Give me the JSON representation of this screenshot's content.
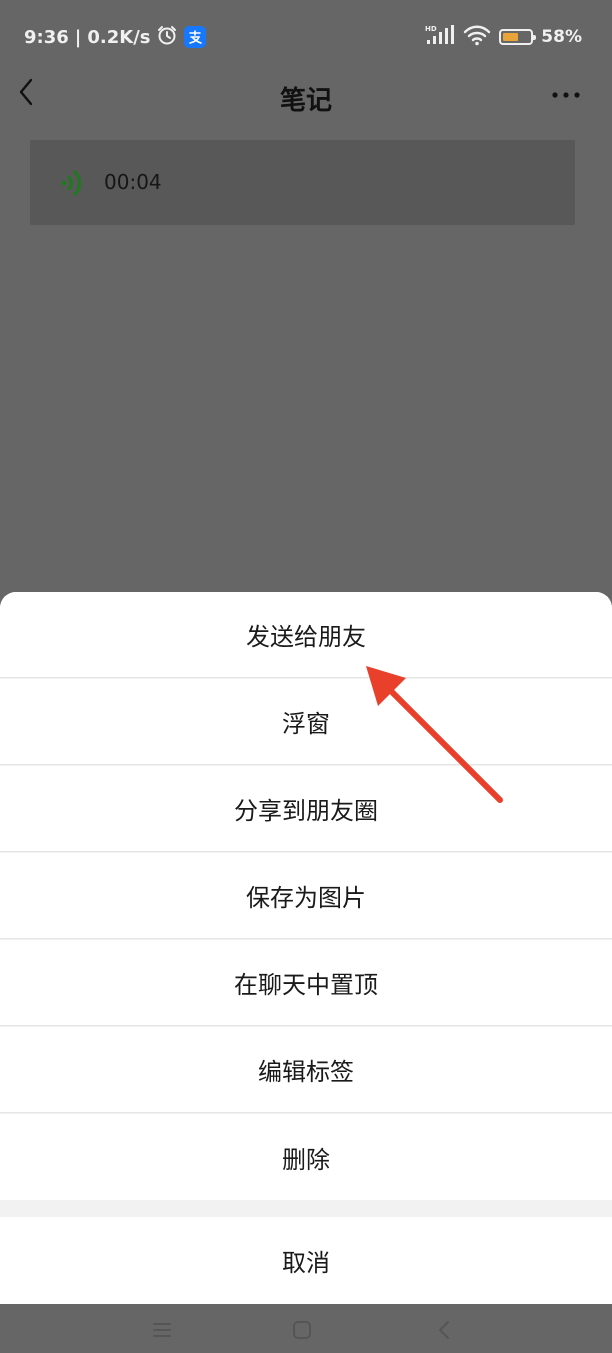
{
  "status_bar": {
    "time": "9:36",
    "network_speed": "0.2K/s",
    "battery_percent": "58%",
    "battery_level": 0.58,
    "icons": [
      "alarm-icon",
      "alipay-icon",
      "hd-signal-icon",
      "wifi-icon",
      "battery-icon"
    ],
    "hd_label": "HD"
  },
  "header": {
    "title": "笔记",
    "back_icon": "chevron-left-icon",
    "more_icon": "more-horizontal-icon"
  },
  "note": {
    "voice_duration": "00:04",
    "voice_icon": "voice-wave-icon",
    "voice_color": "#1f7a1f"
  },
  "action_sheet": {
    "items": [
      {
        "label": "发送给朋友"
      },
      {
        "label": "浮窗"
      },
      {
        "label": "分享到朋友圈"
      },
      {
        "label": "保存为图片"
      },
      {
        "label": "在聊天中置顶"
      },
      {
        "label": "编辑标签"
      },
      {
        "label": "删除"
      }
    ],
    "cancel_label": "取消"
  },
  "nav_bar": {
    "icons": [
      "menu-icon",
      "home-icon",
      "back-icon"
    ]
  },
  "annotation": {
    "arrow_color": "#e8402a",
    "arrow_icon": "arrow-pointer-icon"
  }
}
